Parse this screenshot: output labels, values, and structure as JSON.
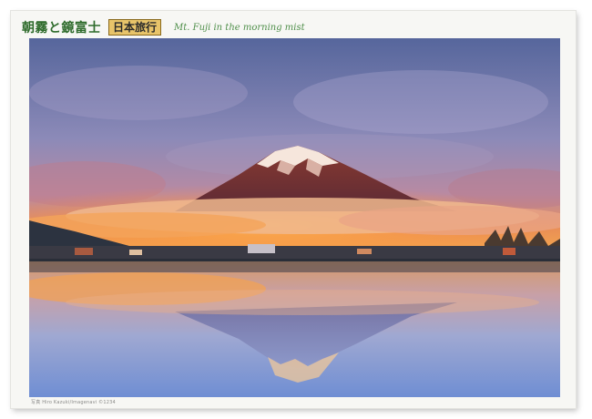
{
  "box": {
    "title_jp": "朝霧と鏡富士",
    "series_label": "日本旅行",
    "title_en": "Mt. Fuji in the morning mist",
    "credit": "写真 Hiro Kazuki/Imagenavi ©1234"
  },
  "photo": {
    "subject": "Mount Fuji reflected in a lake at dawn",
    "colors": {
      "sky_top": "#5a6aa0",
      "sky_mid": "#8d8cbc",
      "glow": "#f08a3a",
      "mist": "#e7b08a",
      "water_top": "#c98a6a",
      "water_bottom": "#7e9ad8"
    }
  }
}
